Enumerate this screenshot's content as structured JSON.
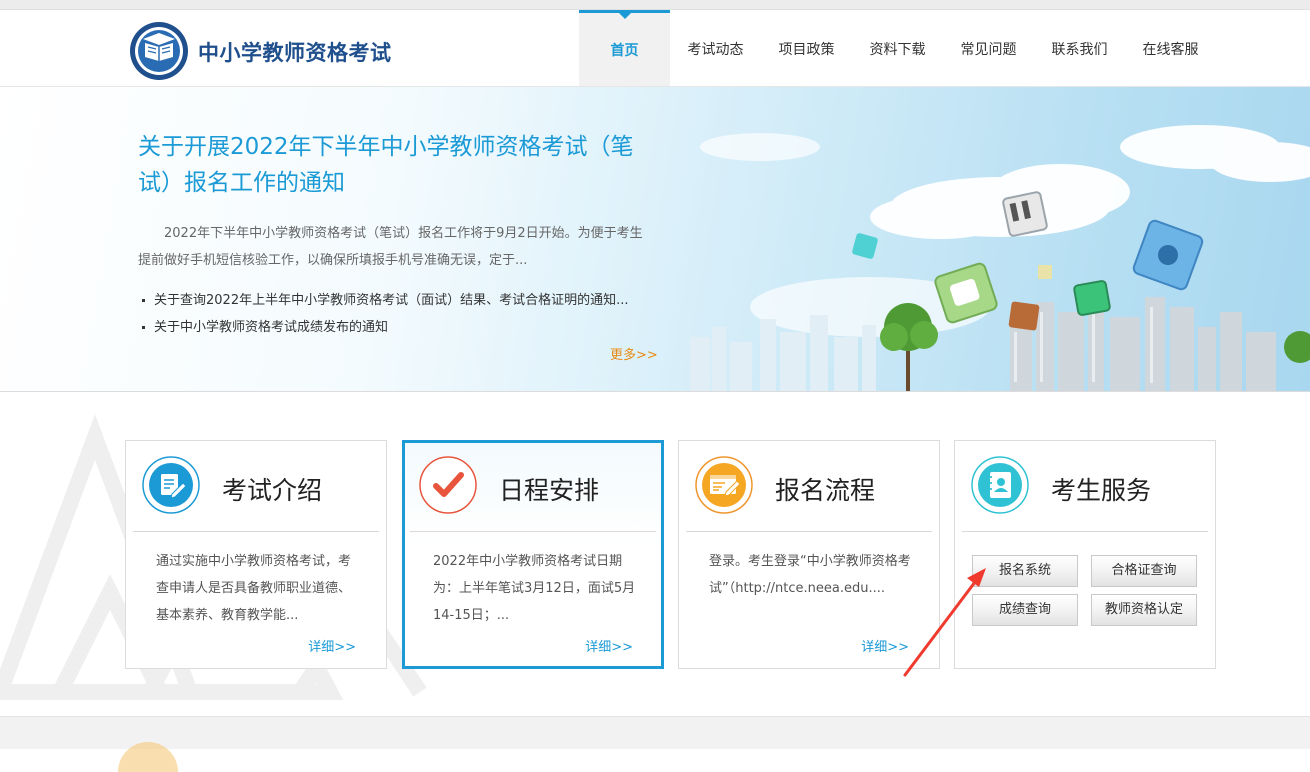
{
  "header": {
    "site_title": "中小学教师资格考试",
    "nav": [
      {
        "label": "首页",
        "active": true
      },
      {
        "label": "考试动态"
      },
      {
        "label": "项目政策"
      },
      {
        "label": "资料下载"
      },
      {
        "label": "常见问题"
      },
      {
        "label": "联系我们"
      },
      {
        "label": "在线客服"
      }
    ]
  },
  "banner": {
    "title": "关于开展2022年下半年中小学教师资格考试（笔试）报名工作的通知",
    "summary": "2022年下半年中小学教师资格考试（笔试）报名工作将于9月2日开始。为便于考生提前做好手机短信核验工作，以确保所填报手机号准确无误，定于...",
    "news": [
      "关于查询2022年上半年中小学教师资格考试（面试）结果、考试合格证明的通知...",
      "关于中小学教师资格考试成绩发布的通知"
    ],
    "more": "更多>>"
  },
  "cards": [
    {
      "title": "考试介绍",
      "icon": "document-edit-icon",
      "text": "通过实施中小学教师资格考试，考查申请人是否具备教师职业道德、基本素养、教育教学能...",
      "detail": "详细>>"
    },
    {
      "title": "日程安排",
      "icon": "checkmark-icon",
      "text": "2022年中小学教师资格考试日期为：上半年笔试3月12日，面试5月14-15日；...",
      "detail": "详细>>"
    },
    {
      "title": "报名流程",
      "icon": "form-edit-icon",
      "text": "登录。考生登录“中小学教师资格考试”（http://ntce.neea.edu....",
      "detail": "详细>>"
    },
    {
      "title": "考生服务",
      "icon": "address-book-icon",
      "buttons": [
        "报名系统",
        "合格证查询",
        "成绩查询",
        "教师资格认定"
      ]
    }
  ],
  "colors": {
    "accent": "#1b9ad6",
    "more_link": "#e88a12",
    "title_blue": "#1f4f8c",
    "annotation_arrow": "#f03a2e"
  }
}
